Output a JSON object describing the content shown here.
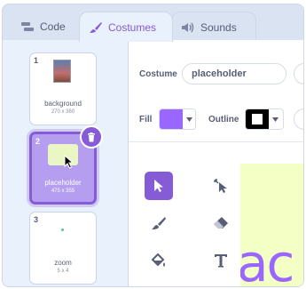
{
  "tabs": {
    "code": "Code",
    "costumes": "Costumes",
    "sounds": "Sounds"
  },
  "costumes": [
    {
      "index": "1",
      "name": "background",
      "size": "270 x 360"
    },
    {
      "index": "2",
      "name": "placeholder",
      "size": "475 x 355"
    },
    {
      "index": "3",
      "name": "zoom",
      "size": "5 x 4"
    }
  ],
  "editor": {
    "costume_label": "Costume",
    "costume_name": "placeholder",
    "fill_label": "Fill",
    "outline_label": "Outline",
    "fill_color": "#9966ff",
    "outline_color": "#000000",
    "canvas_text": "ac"
  },
  "colors": {
    "accent": "#855cd6",
    "canvas_bg": "#f3ffc4"
  },
  "tools": [
    "select-tool",
    "reshape-tool",
    "brush-tool",
    "eraser-tool",
    "fill-tool",
    "text-tool"
  ]
}
